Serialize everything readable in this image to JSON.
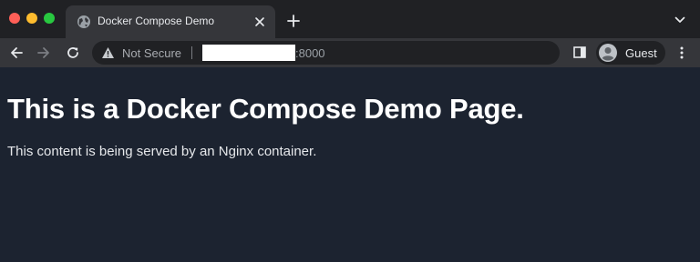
{
  "colors": {
    "close": "#ff5f57",
    "minimize": "#febc2e",
    "zoom": "#28c840",
    "page_background": "#1c2330",
    "tab_strip": "#202124",
    "toolbar": "#35363a"
  },
  "tab": {
    "title": "Docker Compose Demo",
    "icon": "globe-icon"
  },
  "toolbar": {
    "security_label": "Not Secure",
    "url_port": ":8000",
    "profile_label": "Guest"
  },
  "page": {
    "heading": "This is a Docker Compose Demo Page.",
    "body": "This content is being served by an Nginx container."
  }
}
